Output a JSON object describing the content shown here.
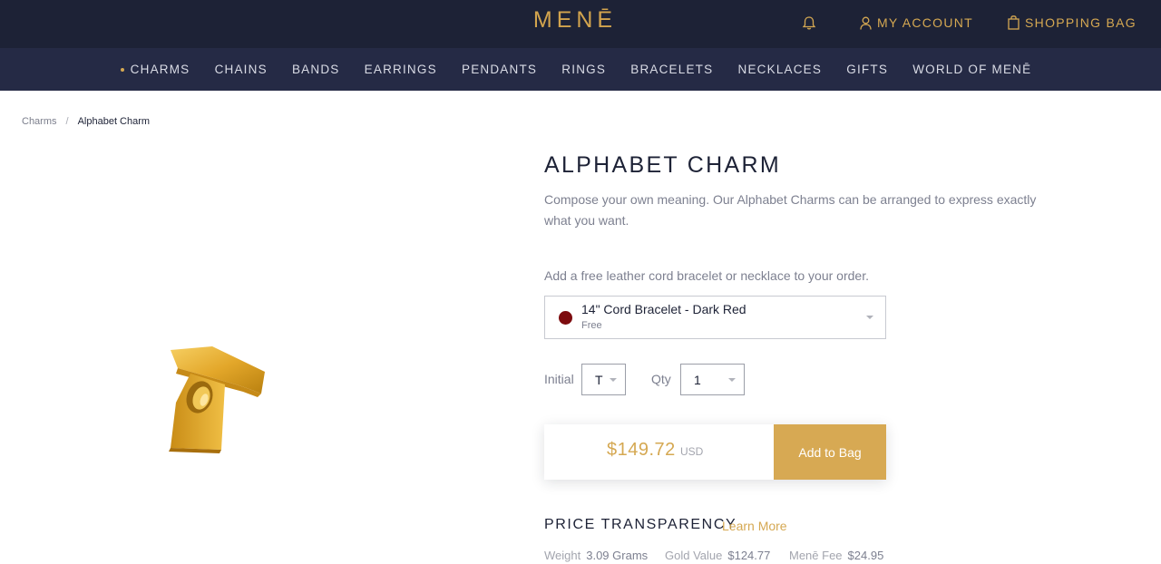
{
  "header": {
    "logo": "MENĒ",
    "notifications_icon": "bell-icon",
    "account_label": "MY ACCOUNT",
    "bag_label": "SHOPPING BAG"
  },
  "nav": {
    "items": [
      "CHARMS",
      "CHAINS",
      "BANDS",
      "EARRINGS",
      "PENDANTS",
      "RINGS",
      "BRACELETS",
      "NECKLACES",
      "GIFTS",
      "WORLD OF MENĒ"
    ],
    "active_index": 0
  },
  "breadcrumb": {
    "parent": "Charms",
    "separator": "/",
    "current": "Alphabet Charm"
  },
  "product": {
    "title": "ALPHABET CHARM",
    "description": "Compose your own meaning. Our Alphabet Charms can be arranged to express exactly what you want.",
    "addon_prompt": "Add a free leather cord bracelet or necklace to your order.",
    "addon": {
      "name": "14\" Cord Bracelet - Dark Red",
      "price_note": "Free",
      "swatch_color": "#7d0c0f"
    },
    "initial_label": "Initial",
    "initial_value": "T",
    "qty_label": "Qty",
    "qty_value": "1",
    "price": "$149.72",
    "currency": "USD",
    "add_to_bag": "Add to Bag"
  },
  "transparency": {
    "title": "PRICE TRANSPARENCY",
    "link": "Learn More",
    "weight_label": "Weight",
    "weight_value": "3.09 Grams",
    "gold_label": "Gold Value",
    "gold_value": "$124.77",
    "fee_label": "Menē Fee",
    "fee_value": "$24.95"
  },
  "colors": {
    "header_bg": "#1d2236",
    "nav_bg": "#252a45",
    "gold_accent": "#d5a852",
    "button_bg": "#d7a953"
  }
}
